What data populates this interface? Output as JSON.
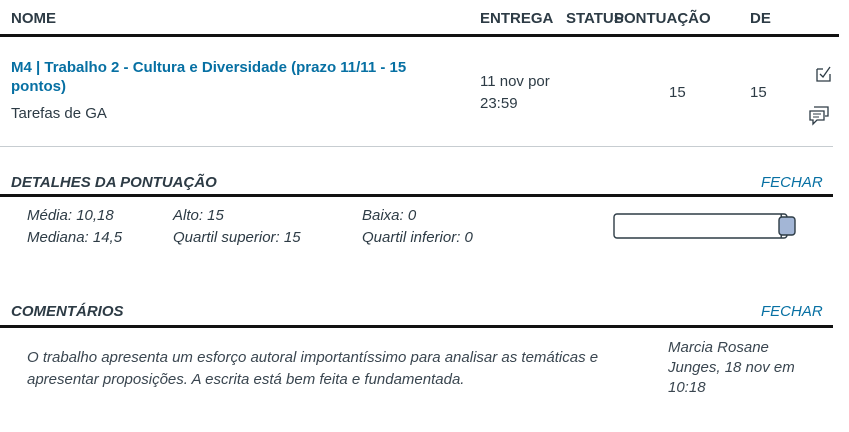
{
  "header": {
    "name": "NOME",
    "due": "ENTREGA",
    "status": "STATUS",
    "score": "PONTUAÇÃO",
    "out_of": "DE"
  },
  "assignment": {
    "title": "M4 | Trabalho 2 - Cultura e Diversidade (prazo 11/11 - 15 pontos)",
    "group": "Tarefas de GA",
    "due_line1": "11 nov por",
    "due_line2": "23:59",
    "score": "15",
    "out_of": "15"
  },
  "score_details": {
    "title": "DETALHES DA PONTUAÇÃO",
    "close_label": "FECHAR",
    "mean": "Média: 10,18",
    "median": "Mediana: 14,5",
    "high": "Alto: 15",
    "upper_quartile": "Quartil superior: 15",
    "low": "Baixa: 0",
    "lower_quartile": "Quartil inferior: 0",
    "box_plot": {
      "min": 0,
      "lower_quartile": 0,
      "median": 14.5,
      "upper_quartile": 15,
      "max": 15,
      "score": 15
    }
  },
  "comments": {
    "title": "COMENTÁRIOS",
    "close_label": "FECHAR",
    "text": "O trabalho apresenta um esforço autoral importantíssimo para analisar as temáticas e apresentar proposições. A escrita está bem feita e fundamentada.",
    "author_line1": "Marcia Rosane",
    "author_line2": "Junges, 18 nov em",
    "author_line3": "10:18"
  },
  "icons": {
    "rubric": "checklist-icon",
    "comments": "comment-bubble-icon"
  },
  "colors": {
    "link": "#0770a3",
    "text": "#2d3b45",
    "score_marker": "#a3b6d6"
  }
}
